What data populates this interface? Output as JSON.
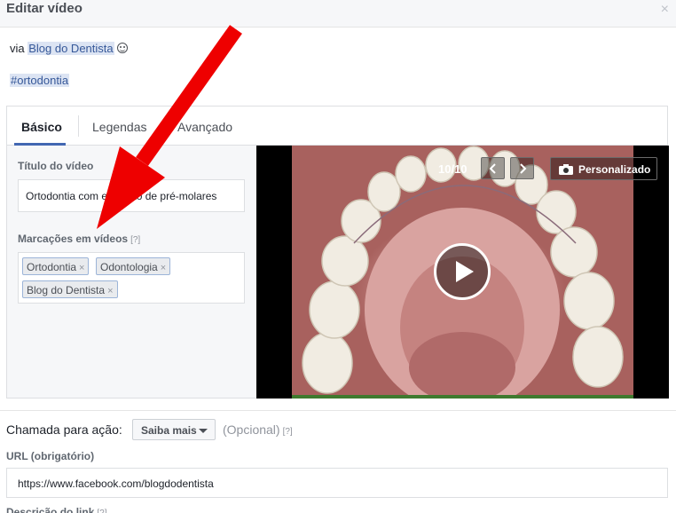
{
  "dialog": {
    "title": "Editar vídeo",
    "close_glyph": "×"
  },
  "post": {
    "via_prefix": "via ",
    "page_mention": "Blog do Dentista",
    "hashtag": "#ortodontia"
  },
  "tabs": [
    {
      "label": "Básico",
      "active": true
    },
    {
      "label": "Legendas",
      "active": false
    },
    {
      "label": "Avançado",
      "active": false
    }
  ],
  "video_title": {
    "label": "Título do vídeo",
    "value": "Ortodontia com extração de pré-molares"
  },
  "video_tags": {
    "label": "Marcações em vídeos",
    "help": "[?]",
    "items": [
      "Ortodontia",
      "Odontologia",
      "Blog do Dentista"
    ],
    "remove_glyph": "×"
  },
  "thumbnail": {
    "counter": "10/10",
    "custom_label": "Personalizado"
  },
  "cta": {
    "label": "Chamada para ação:",
    "selected": "Saiba mais",
    "optional": "(Opcional)",
    "help": "[?]"
  },
  "url": {
    "label": "URL (obrigatório)",
    "value": "https://www.facebook.com/blogdodentista"
  },
  "link_description": {
    "label": "Descrição do link",
    "help": "[?]"
  },
  "colors": {
    "accent": "#4267b2",
    "annotation_arrow": "#ee0000"
  }
}
